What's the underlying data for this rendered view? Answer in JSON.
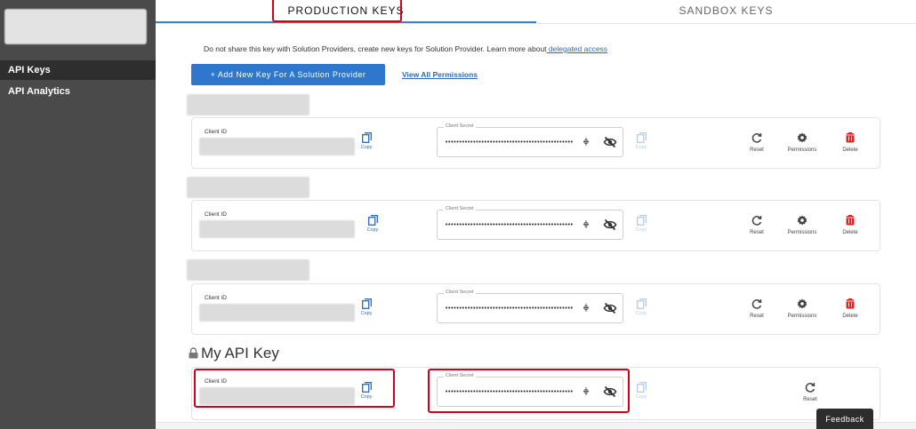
{
  "sidebar": {
    "items": [
      {
        "label": "API Keys",
        "active": true
      },
      {
        "label": "API Analytics",
        "active": false
      }
    ]
  },
  "tabs": [
    {
      "label": "PRODUCTION KEYS",
      "active": true
    },
    {
      "label": "SANDBOX KEYS",
      "active": false
    }
  ],
  "notice": {
    "text": "Do not share this key with Solution Providers, create new keys for Solution Provider. Learn more about",
    "link": " delegated access"
  },
  "actions": {
    "add_button": "+ Add New Key For A Solution Provider",
    "view_permissions": "View All Permissions"
  },
  "keys": [
    {
      "client_id_label": "Client ID",
      "copy_label": "Copy",
      "secret_label": "Client Secret",
      "secret_value": "••••••••••••••••••••••••••••••••••••••••••••••",
      "reset_label": "Reset",
      "permissions_label": "Permissions",
      "delete_label": "Delete"
    },
    {
      "client_id_label": "Client ID",
      "copy_label": "Copy",
      "secret_label": "Client Secret",
      "secret_value": "••••••••••••••••••••••••••••••••••••••••••••••",
      "reset_label": "Reset",
      "permissions_label": "Permissions",
      "delete_label": "Delete"
    },
    {
      "client_id_label": "Client ID",
      "copy_label": "Copy",
      "secret_label": "Client Secret",
      "secret_value": "••••••••••••••••••••••••••••••••••••••••••••••",
      "reset_label": "Reset",
      "permissions_label": "Permissions",
      "delete_label": "Delete"
    }
  ],
  "my_key": {
    "title": "My API Key",
    "client_id_label": "Client ID",
    "copy_label": "Copy",
    "secret_label": "Client Secret",
    "secret_value": "••••••••••••••••••••••••••••••••••••••••••••••",
    "reset_label": "Reset"
  },
  "disabled_copy_label": "Copy",
  "feedback_label": "Feedback",
  "colors": {
    "sidebar_bg": "#4a4a4a",
    "sidebar_active": "#2e2e2e",
    "primary": "#2f77cc",
    "link": "#2b6cb5",
    "delete": "#e02424",
    "highlight": "#d0021b"
  },
  "icons": [
    "copy-icon",
    "caret-icon",
    "eye-slash-icon",
    "reset-icon",
    "gear-icon",
    "trash-icon",
    "lock-icon"
  ]
}
